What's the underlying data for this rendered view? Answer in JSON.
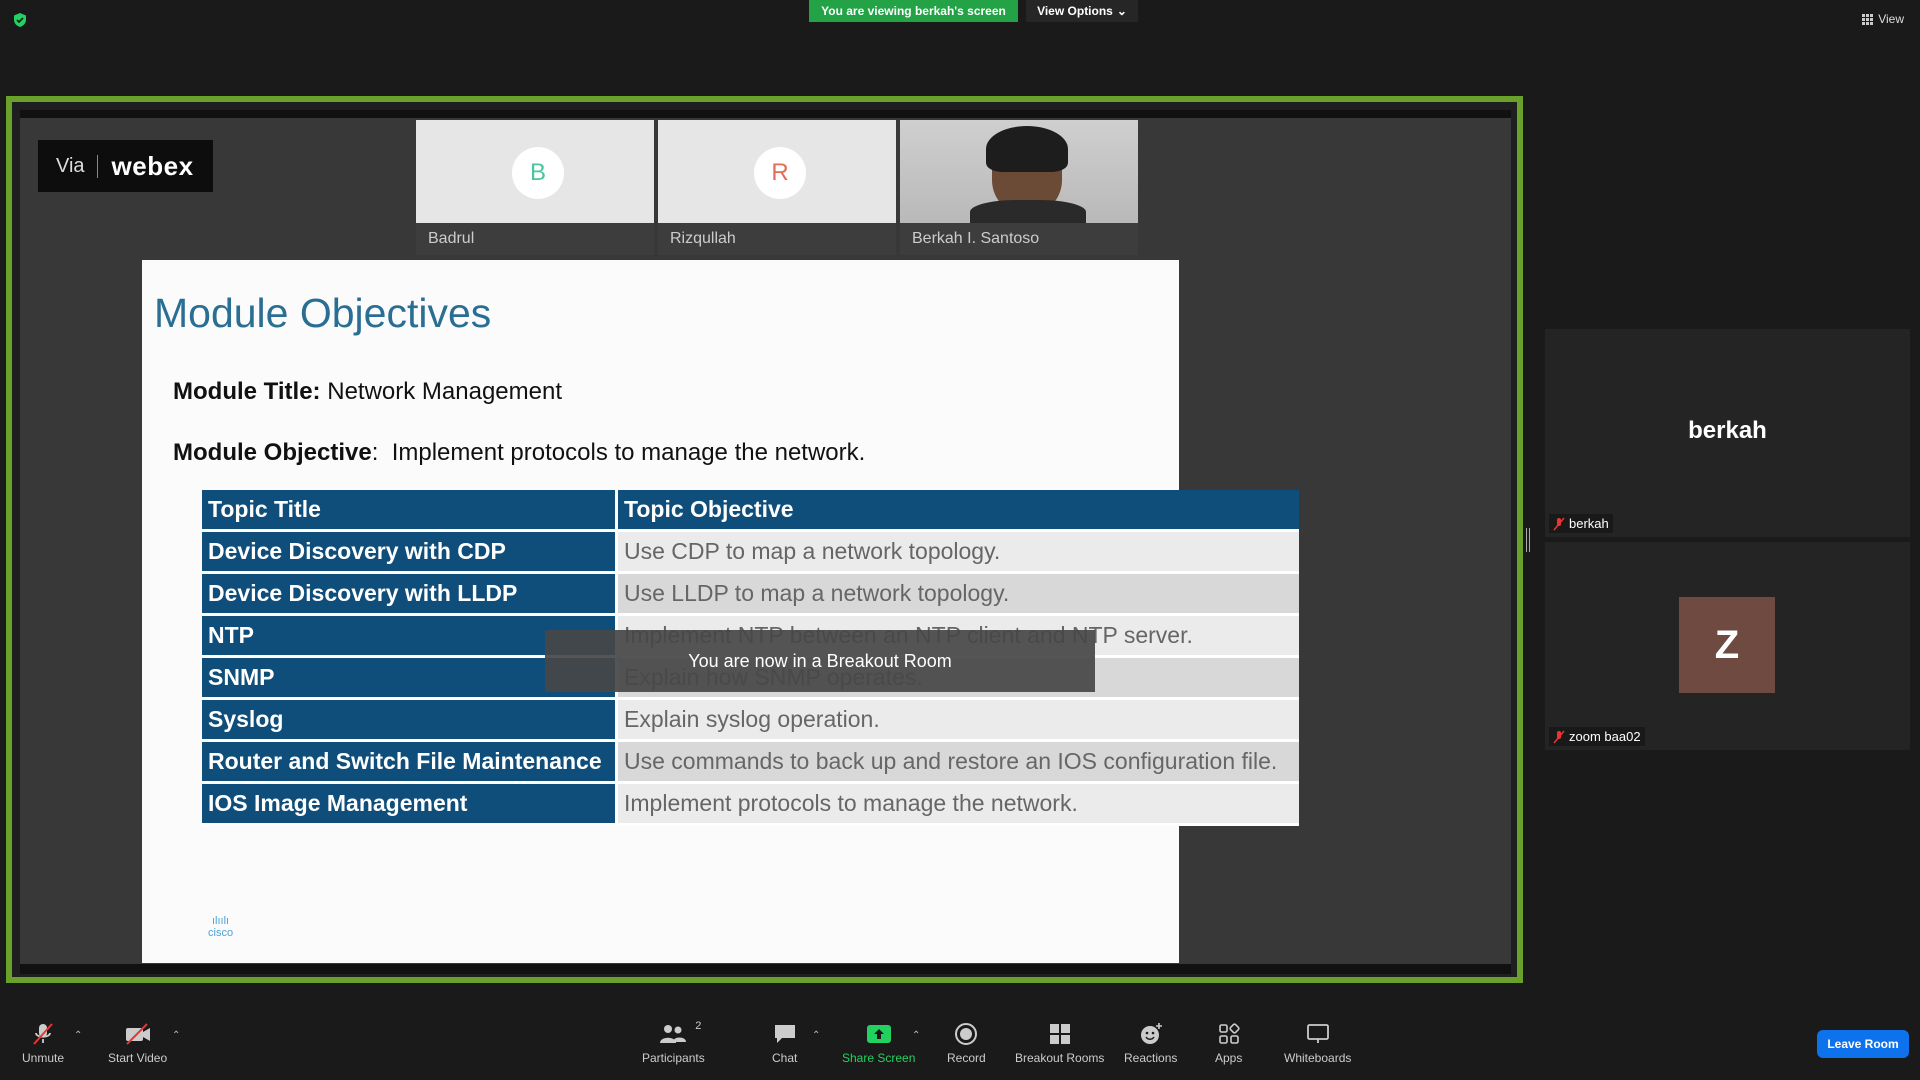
{
  "banner": {
    "viewing_text": "You are viewing berkah's screen",
    "view_options_label": "View Options"
  },
  "top_right": {
    "view_label": "View"
  },
  "shared": {
    "webex_logo": {
      "via": "Via",
      "brand": "webex"
    },
    "tiles": [
      {
        "initial": "B",
        "name": "Badrul",
        "initial_color": "#4dc4a0"
      },
      {
        "initial": "R",
        "name": "Rizqullah",
        "initial_color": "#e26c5a"
      },
      {
        "name": "Berkah I. Santoso"
      }
    ],
    "slide": {
      "title": "Module Objectives",
      "module_title_label": "Module Title:",
      "module_title_value": "Network Management",
      "module_objective_label": "Module Objective",
      "module_objective_value": "Implement protocols to manage the network.",
      "table_headers": [
        "Topic Title",
        "Topic Objective"
      ],
      "table_rows": [
        [
          "Device Discovery with CDP",
          "Use CDP to map a network topology."
        ],
        [
          "Device Discovery with LLDP",
          "Use LLDP to map a network topology."
        ],
        [
          "NTP",
          "Implement NTP between an NTP client and NTP server."
        ],
        [
          "SNMP",
          "Explain how SNMP operates."
        ],
        [
          "Syslog",
          "Explain syslog operation."
        ],
        [
          "Router and Switch File Maintenance",
          "Use commands to back up and restore an IOS configuration file."
        ],
        [
          "IOS Image Management",
          "Implement protocols to manage the network."
        ]
      ],
      "cisco_logo": "cisco"
    },
    "toast": "You are now in a Breakout Room"
  },
  "participants": [
    {
      "display": "berkah",
      "label": "berkah"
    },
    {
      "avatar_letter": "Z",
      "label": "zoom baa02"
    }
  ],
  "toolbar": {
    "unmute": "Unmute",
    "start_video": "Start Video",
    "participants": "Participants",
    "participants_count": "2",
    "chat": "Chat",
    "share_screen": "Share Screen",
    "record": "Record",
    "breakout_rooms": "Breakout Rooms",
    "reactions": "Reactions",
    "apps": "Apps",
    "whiteboards": "Whiteboards",
    "leave": "Leave Room"
  },
  "colors": {
    "share_border": "#6aa12a",
    "banner_green": "#23a346",
    "leave_blue": "#0e72ed",
    "share_green": "#23d160"
  }
}
